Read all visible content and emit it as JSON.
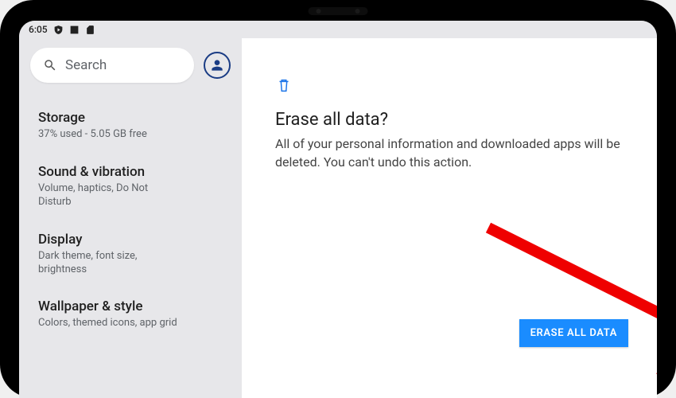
{
  "status_bar": {
    "time": "6:05"
  },
  "sidebar": {
    "search_placeholder": "Search",
    "items": [
      {
        "title": "Storage",
        "subtitle": "37% used - 5.05 GB free"
      },
      {
        "title": "Sound & vibration",
        "subtitle": "Volume, haptics, Do Not Disturb"
      },
      {
        "title": "Display",
        "subtitle": "Dark theme, font size, brightness"
      },
      {
        "title": "Wallpaper & style",
        "subtitle": "Colors, themed icons, app grid"
      }
    ]
  },
  "main": {
    "title": "Erase all data?",
    "description": "All of your personal information and downloaded apps will be deleted. You can't undo this action.",
    "erase_button": "ERASE ALL DATA"
  },
  "colors": {
    "accent_blue": "#1a8cff",
    "link_blue": "#1a73e8",
    "annotation_red": "#ef0000"
  }
}
